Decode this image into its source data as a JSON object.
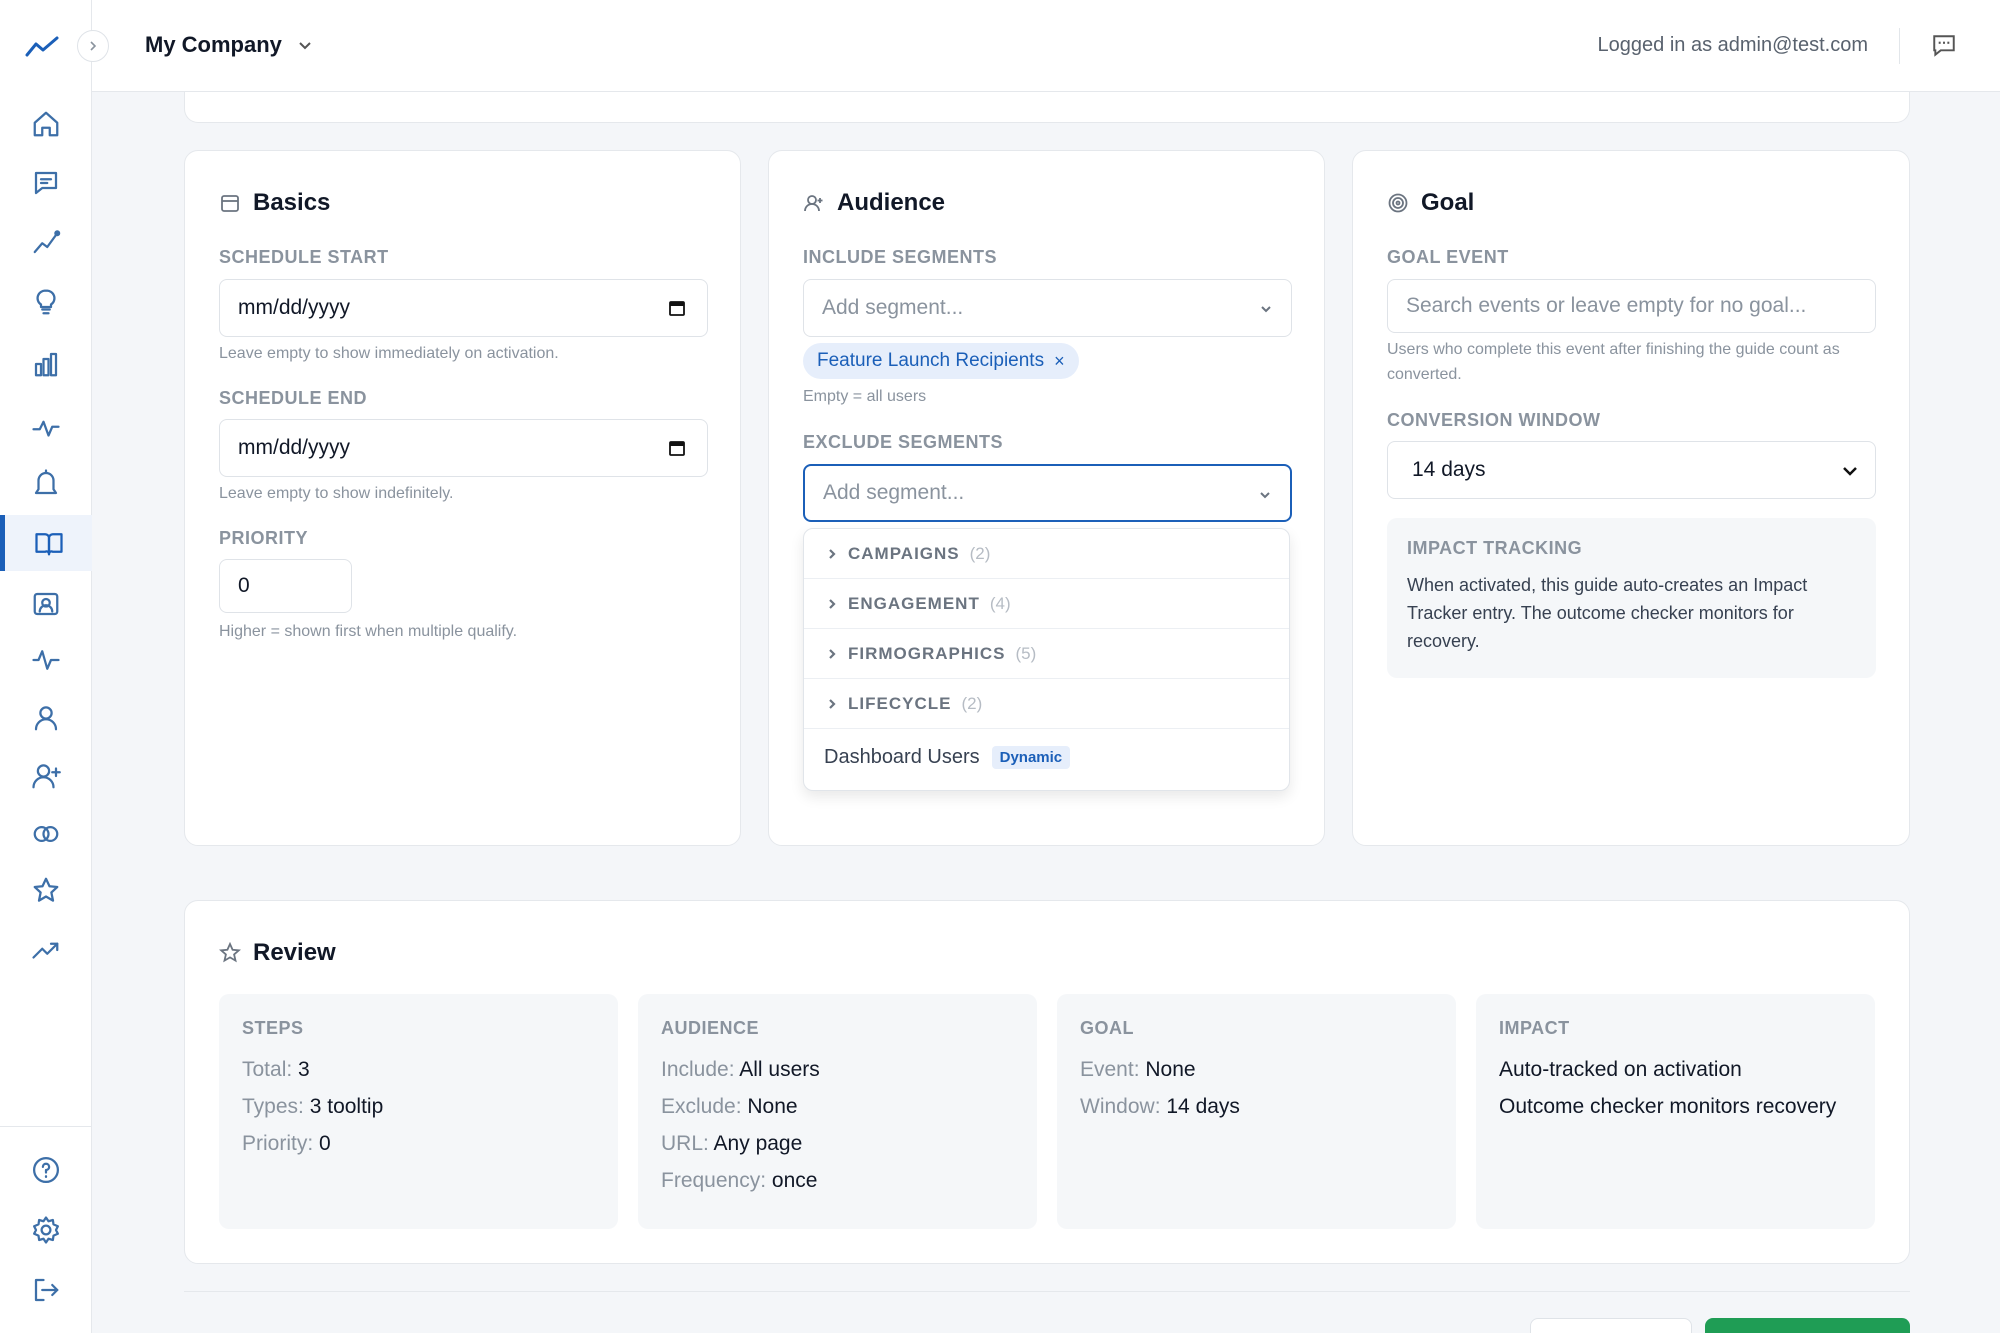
{
  "header": {
    "company": "My Company",
    "logged_in": "Logged in as admin@test.com"
  },
  "sidebar": {
    "icons": [
      "home-icon",
      "message-icon",
      "trend-icon",
      "lightbulb-icon",
      "bar-chart-icon",
      "activity-icon",
      "bell-icon",
      "book-icon",
      "contact-icon",
      "pulse-icon",
      "user-icon",
      "user-plus-icon",
      "link-icon",
      "star-icon",
      "trending-up-icon",
      "help-icon",
      "settings-icon",
      "logout-icon"
    ],
    "active": "book-icon"
  },
  "basics": {
    "title": "Basics",
    "schedule_start_label": "SCHEDULE START",
    "schedule_start_value": "mm/dd/yyyy",
    "schedule_start_help": "Leave empty to show immediately on activation.",
    "schedule_end_label": "SCHEDULE END",
    "schedule_end_value": "mm/dd/yyyy",
    "schedule_end_help": "Leave empty to show indefinitely.",
    "priority_label": "PRIORITY",
    "priority_value": "0",
    "priority_help": "Higher = shown first when multiple qualify."
  },
  "audience": {
    "title": "Audience",
    "include_label": "INCLUDE SEGMENTS",
    "include_placeholder": "Add segment...",
    "include_chip": "Feature Launch Recipients",
    "chip_remove": "×",
    "include_help": "Empty = all users",
    "exclude_label": "EXCLUDE SEGMENTS",
    "exclude_placeholder": "Add segment...",
    "dropdown": {
      "groups": [
        {
          "name": "CAMPAIGNS",
          "count": "(2)"
        },
        {
          "name": "ENGAGEMENT",
          "count": "(4)"
        },
        {
          "name": "FIRMOGRAPHICS",
          "count": "(5)"
        },
        {
          "name": "LIFECYCLE",
          "count": "(2)"
        }
      ],
      "item": "Dashboard Users",
      "item_badge": "Dynamic"
    }
  },
  "goal": {
    "title": "Goal",
    "event_label": "GOAL EVENT",
    "event_placeholder": "Search events or leave empty for no goal...",
    "event_help": "Users who complete this event after finishing the guide count as converted.",
    "window_label": "CONVERSION WINDOW",
    "window_value": "14 days",
    "impact_title": "IMPACT TRACKING",
    "impact_text": "When activated, this guide auto-creates an Impact Tracker entry. The outcome checker monitors for recovery."
  },
  "review": {
    "title": "Review",
    "steps": {
      "head": "STEPS",
      "total_k": "Total:",
      "total_v": "3",
      "types_k": "Types:",
      "types_v": "3 tooltip",
      "priority_k": "Priority:",
      "priority_v": "0"
    },
    "audience": {
      "head": "AUDIENCE",
      "include_k": "Include:",
      "include_v": "All users",
      "exclude_k": "Exclude:",
      "exclude_v": "None",
      "url_k": "URL:",
      "url_v": "Any page",
      "freq_k": "Frequency:",
      "freq_v": "once"
    },
    "goal": {
      "head": "GOAL",
      "event_k": "Event:",
      "event_v": "None",
      "window_k": "Window:",
      "window_v": "14 days"
    },
    "impact": {
      "head": "IMPACT",
      "line1": "Auto-tracked on activation",
      "line2": "Outcome checker monitors recovery"
    }
  },
  "colors": {
    "accent": "#1b5fb8",
    "primary_button": "#1f9d55"
  }
}
